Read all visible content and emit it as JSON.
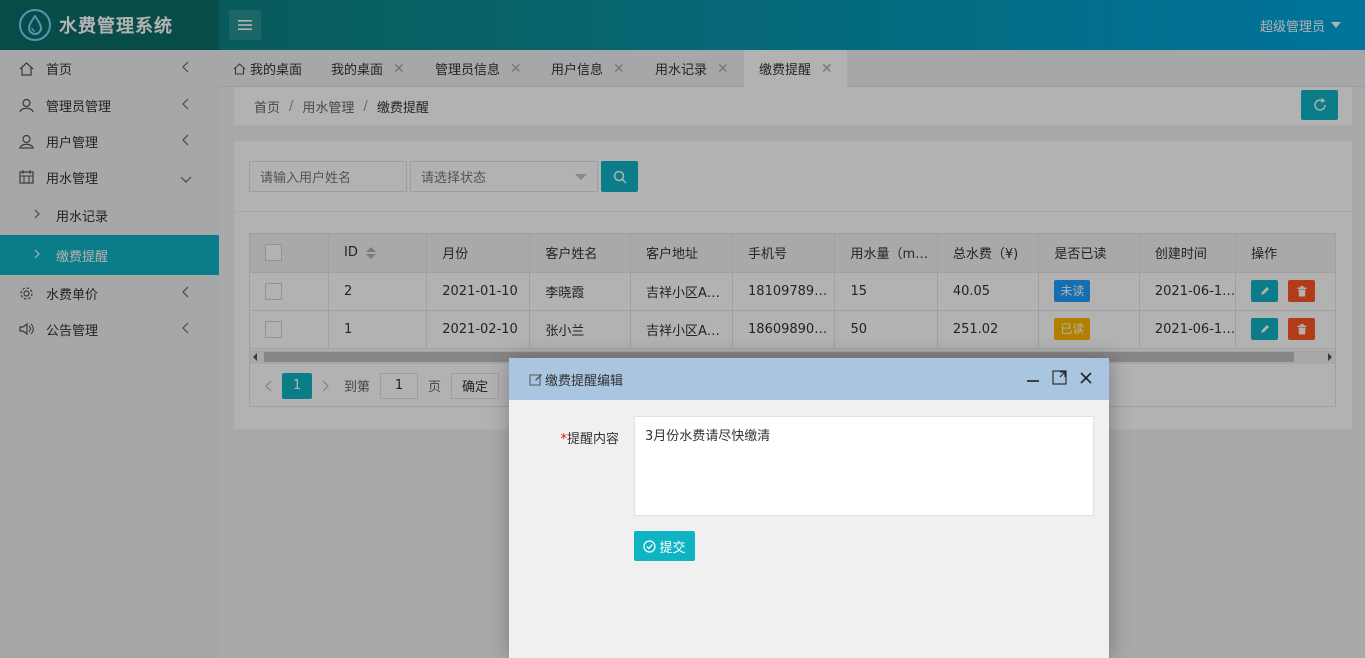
{
  "app": {
    "title": "水费管理系统",
    "user": "超级管理员"
  },
  "sidebar": {
    "items": [
      {
        "label": "首页",
        "icon": "home-icon"
      },
      {
        "label": "管理员管理",
        "icon": "admin-user-icon"
      },
      {
        "label": "用户管理",
        "icon": "user-icon"
      },
      {
        "label": "用水管理",
        "icon": "calendar-icon"
      },
      {
        "label": "水费单价",
        "icon": "gear-icon"
      },
      {
        "label": "公告管理",
        "icon": "speaker-icon"
      }
    ],
    "sub_items": [
      {
        "label": "用水记录",
        "active": false
      },
      {
        "label": "缴费提醒",
        "active": true
      }
    ]
  },
  "tabs": [
    {
      "label": "我的桌面",
      "home": true
    },
    {
      "label": "我的桌面"
    },
    {
      "label": "管理员信息"
    },
    {
      "label": "用户信息"
    },
    {
      "label": "用水记录"
    },
    {
      "label": "缴费提醒",
      "active": true
    }
  ],
  "breadcrumb": [
    "首页",
    "用水管理",
    "缴费提醒"
  ],
  "search": {
    "name_placeholder": "请输入用户姓名",
    "status_placeholder": "请选择状态"
  },
  "table": {
    "headers": [
      "ID",
      "月份",
      "客户姓名",
      "客户地址",
      "手机号",
      "用水量（m…",
      "总水费（¥)",
      "是否已读",
      "创建时间",
      "操作"
    ],
    "rows": [
      {
        "id": "2",
        "month": "2021-01-10",
        "name": "李晓霞",
        "address": "吉祥小区A…",
        "phone": "18109789…",
        "usage": "15",
        "fee": "40.05",
        "read": "未读",
        "created": "2021-06-1…"
      },
      {
        "id": "1",
        "month": "2021-02-10",
        "name": "张小兰",
        "address": "吉祥小区A…",
        "phone": "18609890…",
        "usage": "50",
        "fee": "251.02",
        "read": "已读",
        "created": "2021-06-1…"
      }
    ]
  },
  "pager": {
    "current": "1",
    "goto_label": "到第",
    "goto_value": "1",
    "page_label": "页",
    "confirm_label": "确定"
  },
  "dialog": {
    "title": "缴费提醒编辑",
    "field_label": "提醒内容",
    "field_value": "3月份水费请尽快缴清",
    "submit_label": "提交"
  },
  "colors": {
    "accent": "#0fb4c3",
    "unread": "#1e9fff",
    "read": "#ffb800",
    "delete": "#ff5722"
  }
}
